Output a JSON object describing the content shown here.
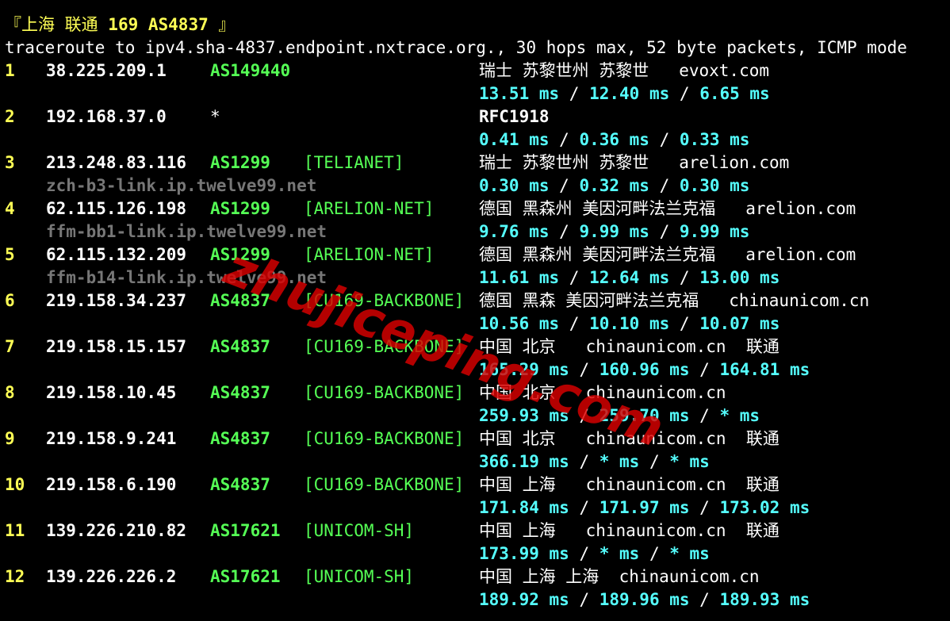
{
  "title": {
    "open": "『上海 联通 ",
    "highlight": "169 AS4837",
    "close": " 』"
  },
  "command_line": "traceroute to ipv4.sha-4837.endpoint.nxtrace.org., 30 hops max, 52 byte packets, ICMP mode",
  "hops": [
    {
      "num": "1",
      "ip": "38.225.209.1",
      "asn": "AS149440",
      "tag": "",
      "geo": "瑞士 苏黎世州 苏黎世   evoxt.com",
      "rdns": "",
      "rtt": [
        "13.51 ms",
        "12.40 ms",
        "6.65 ms"
      ]
    },
    {
      "num": "2",
      "ip": "192.168.37.0",
      "asn": "*",
      "tag": "",
      "geo": "RFC1918",
      "rdns": "",
      "rtt": [
        "0.41 ms",
        "0.36 ms",
        "0.33 ms"
      ]
    },
    {
      "num": "3",
      "ip": "213.248.83.116",
      "asn": "AS1299",
      "tag": "[TELIANET]",
      "geo": "瑞士 苏黎世州 苏黎世   arelion.com",
      "rdns": "zch-b3-link.ip.twelve99.net",
      "rtt": [
        "0.30 ms",
        "0.32 ms",
        "0.30 ms"
      ]
    },
    {
      "num": "4",
      "ip": "62.115.126.198",
      "asn": "AS1299",
      "tag": "[ARELION-NET]",
      "geo": "德国 黑森州 美因河畔法兰克福   arelion.com",
      "rdns": "ffm-bb1-link.ip.twelve99.net",
      "rtt": [
        "9.76 ms",
        "9.99 ms",
        "9.99 ms"
      ]
    },
    {
      "num": "5",
      "ip": "62.115.132.209",
      "asn": "AS1299",
      "tag": "[ARELION-NET]",
      "geo": "德国 黑森州 美因河畔法兰克福   arelion.com",
      "rdns": "ffm-b14-link.ip.twelve99.net",
      "rtt": [
        "11.61 ms",
        "12.64 ms",
        "13.00 ms"
      ]
    },
    {
      "num": "6",
      "ip": "219.158.34.237",
      "asn": "AS4837",
      "tag": "[CU169-BACKBONE]",
      "geo": "德国 黑森 美因河畔法兰克福   chinaunicom.cn",
      "rdns": "",
      "rtt": [
        "10.56 ms",
        "10.10 ms",
        "10.07 ms"
      ]
    },
    {
      "num": "7",
      "ip": "219.158.15.157",
      "asn": "AS4837",
      "tag": "[CU169-BACKBONE]",
      "geo": "中国 北京   chinaunicom.cn  联通",
      "rdns": "",
      "rtt": [
        "165.29 ms",
        "160.96 ms",
        "164.81 ms"
      ]
    },
    {
      "num": "8",
      "ip": "219.158.10.45",
      "asn": "AS4837",
      "tag": "[CU169-BACKBONE]",
      "geo": "中国 北京   chinaunicom.cn",
      "rdns": "",
      "rtt": [
        "259.93 ms",
        "259.70 ms",
        "* ms"
      ]
    },
    {
      "num": "9",
      "ip": "219.158.9.241",
      "asn": "AS4837",
      "tag": "[CU169-BACKBONE]",
      "geo": "中国 北京   chinaunicom.cn  联通",
      "rdns": "",
      "rtt": [
        "366.19 ms",
        "* ms",
        "* ms"
      ]
    },
    {
      "num": "10",
      "ip": "219.158.6.190",
      "asn": "AS4837",
      "tag": "[CU169-BACKBONE]",
      "geo": "中国 上海   chinaunicom.cn  联通",
      "rdns": "",
      "rtt": [
        "171.84 ms",
        "171.97 ms",
        "173.02 ms"
      ]
    },
    {
      "num": "11",
      "ip": "139.226.210.82",
      "asn": "AS17621",
      "tag": "[UNICOM-SH]",
      "geo": "中国 上海   chinaunicom.cn  联通",
      "rdns": "",
      "rtt": [
        "173.99 ms",
        "* ms",
        "* ms"
      ]
    },
    {
      "num": "12",
      "ip": "139.226.226.2",
      "asn": "AS17621",
      "tag": "[UNICOM-SH]",
      "geo": "中国 上海 上海  chinaunicom.cn",
      "rdns": "",
      "rtt": [
        "189.92 ms",
        "189.96 ms",
        "189.93 ms"
      ]
    }
  ],
  "rtt_separator": " / ",
  "watermark": "zhujiceping.com"
}
